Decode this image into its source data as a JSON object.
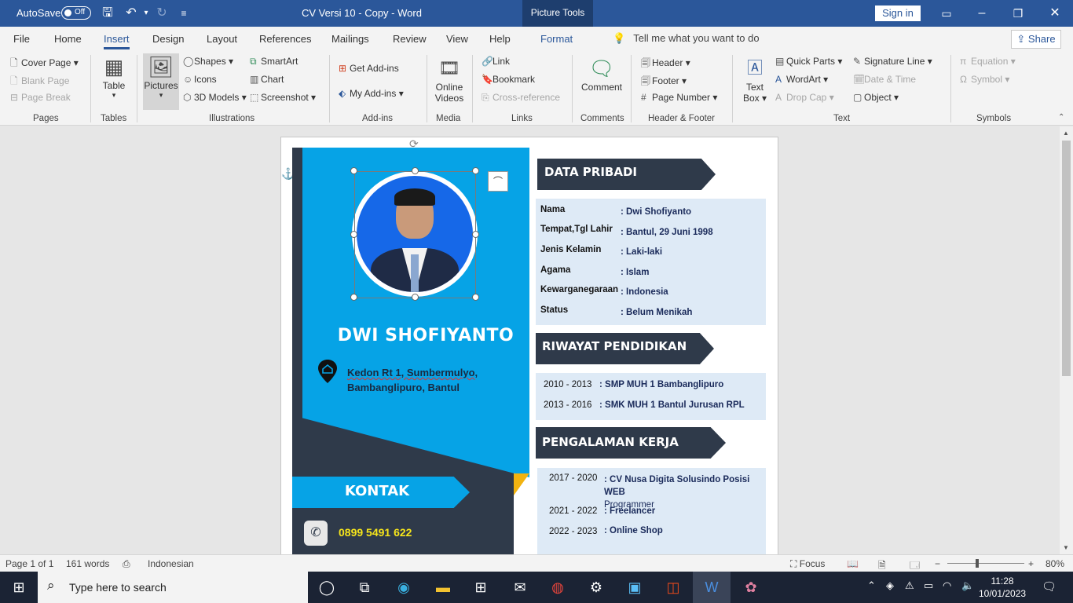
{
  "titlebar": {
    "autosave_label": "AutoSave",
    "autosave_state": "Off",
    "doc_title": "CV Versi 10 - Copy  -  Word",
    "context_tab": "Picture Tools",
    "signin": "Sign in"
  },
  "tabs": [
    "File",
    "Home",
    "Insert",
    "Design",
    "Layout",
    "References",
    "Mailings",
    "Review",
    "View",
    "Help",
    "Format"
  ],
  "active_tab": "Insert",
  "tellme": "Tell me what you want to do",
  "share": "Share",
  "ribbon": {
    "pages": {
      "items": [
        "Cover Page",
        "Blank Page",
        "Page Break"
      ],
      "group": "Pages"
    },
    "tables": {
      "button": "Table",
      "group": "Tables"
    },
    "illustrations": {
      "pictures": "Pictures",
      "items": [
        "Shapes",
        "Icons",
        "3D Models",
        "SmartArt",
        "Chart",
        "Screenshot"
      ],
      "group": "Illustrations"
    },
    "addins": {
      "items": [
        "Get Add-ins",
        "My Add-ins"
      ],
      "group": "Add-ins"
    },
    "media": {
      "line1": "Online",
      "line2": "Videos",
      "group": "Media"
    },
    "links": {
      "items": [
        "Link",
        "Bookmark",
        "Cross-reference"
      ],
      "group": "Links"
    },
    "comments": {
      "button": "Comment",
      "group": "Comments"
    },
    "header_footer": {
      "items": [
        "Header",
        "Footer",
        "Page Number"
      ],
      "group": "Header & Footer"
    },
    "text": {
      "textbox1": "Text",
      "textbox2": "Box",
      "items": [
        "Quick Parts",
        "WordArt",
        "Drop Cap",
        "Signature Line",
        "Date & Time",
        "Object"
      ],
      "group": "Text"
    },
    "symbols": {
      "items": [
        "Equation",
        "Symbol"
      ],
      "group": "Symbols"
    }
  },
  "cv": {
    "name": "DWI SHOFIYANTO",
    "address_line1": "Kedon Rt 1, Sumbermulyo,",
    "address_line2": "Bambanglipuro, Bantul",
    "kontak": "KONTAK",
    "phone": "0899 5491 622",
    "data_pribadi": {
      "title": "DATA PRIBADI",
      "rows": [
        {
          "label": "Nama",
          "value": ": Dwi Shofiyanto"
        },
        {
          "label": "Tempat,Tgl Lahir",
          "value": ": Bantul, 29 Juni 1998"
        },
        {
          "label": "Jenis Kelamin",
          "value": ": Laki-laki"
        },
        {
          "label": "Agama",
          "value": ": Islam"
        },
        {
          "label": "Kewarganegaraan",
          "value": ": Indonesia"
        },
        {
          "label": "Status",
          "value": ": Belum Menikah"
        }
      ]
    },
    "pendidikan": {
      "title": "RIWAYAT PENDIDIKAN",
      "rows": [
        {
          "year": "2010 - 2013",
          "value": ": SMP MUH 1 Bambanglipuro"
        },
        {
          "year": "2013 - 2016",
          "value": ": SMK MUH 1 Bantul Jurusan RPL"
        }
      ]
    },
    "pengalaman": {
      "title": "PENGALAMAN KERJA",
      "rows": [
        {
          "year": "2017 - 2020",
          "value": ": CV Nusa Digita Solusindo Posisi WEB",
          "value2": "Programmer"
        },
        {
          "year": "2021 - 2022",
          "value": ": Freelancer"
        },
        {
          "year": "2022 - 2023",
          "value": ": Online Shop"
        }
      ]
    }
  },
  "status": {
    "page": "Page 1 of 1",
    "words": "161 words",
    "language": "Indonesian",
    "focus": "Focus",
    "zoom": "80%"
  },
  "taskbar": {
    "search_placeholder": "Type here to search",
    "time": "11:28",
    "date": "10/01/2023"
  }
}
